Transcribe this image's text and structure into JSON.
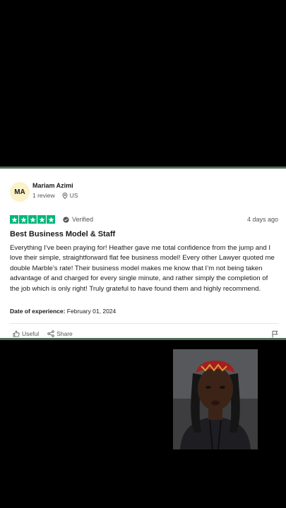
{
  "review": {
    "avatar_initials": "MA",
    "reviewer_name": "Mariam Azimi",
    "review_count": "1 review",
    "country": "US",
    "rating": 5,
    "verified_label": "Verified",
    "posted_ago": "4 days ago",
    "title": "Best Business Model & Staff",
    "body": "Everything I’ve been praying for! Heather gave me total confidence from the jump and I love their simple, straightforward flat fee business model! Every other Lawyer quoted me double Marble’s rate! Their business model makes me know that I’m not being taken advantage of and charged for every single minute, and rather simply the completion of the job which is only right! Truly grateful to have found them and highly recommend.",
    "experience_label": "Date of experience:",
    "experience_date": "February 01, 2024",
    "useful_label": "Useful",
    "share_label": "Share"
  },
  "colors": {
    "star_green": "#00b67a",
    "avatar_bg": "#fbf2c9",
    "frame_green": "#4f6e58"
  }
}
